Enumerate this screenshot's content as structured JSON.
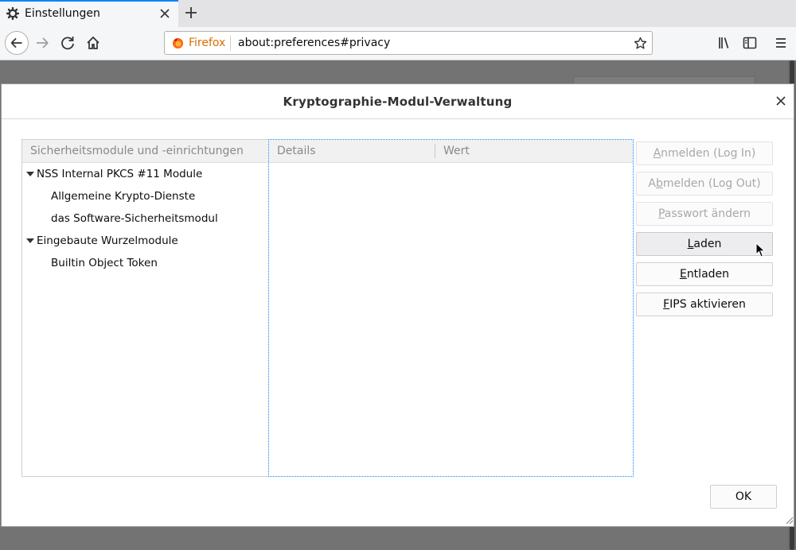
{
  "tab": {
    "title": "Einstellungen",
    "icon": "gear-icon"
  },
  "urlbar": {
    "identity": "Firefox",
    "url": "about:preferences#privacy"
  },
  "dialog": {
    "title": "Kryptographie-Modul-Verwaltung",
    "tree": {
      "header": "Sicherheitsmodule und -einrichtungen",
      "rows": [
        {
          "label": "NSS Internal PKCS #11 Module",
          "level": 1,
          "expanded": true
        },
        {
          "label": "Allgemeine Krypto-Dienste",
          "level": 2
        },
        {
          "label": "das Software-Sicherheitsmodul",
          "level": 2
        },
        {
          "label": "Eingebaute Wurzelmodule",
          "level": 1,
          "expanded": true
        },
        {
          "label": "Builtin Object Token",
          "level": 2
        }
      ]
    },
    "details": {
      "col1": "Details",
      "col2": "Wert"
    },
    "buttons": [
      {
        "pre": "",
        "acc": "A",
        "post": "nmelden (Log In)",
        "disabled": true
      },
      {
        "pre": "A",
        "acc": "b",
        "post": "melden (Log Out)",
        "disabled": true
      },
      {
        "pre": "",
        "acc": "P",
        "post": "asswort ändern",
        "disabled": true
      },
      {
        "pre": "",
        "acc": "L",
        "post": "aden",
        "disabled": false,
        "hover": true
      },
      {
        "pre": "",
        "acc": "E",
        "post": "ntladen",
        "disabled": false
      },
      {
        "pre": "",
        "acc": "F",
        "post": "IPS aktivieren",
        "disabled": false
      }
    ],
    "ok_label": "OK"
  },
  "colors": {
    "accent": "#0a84ff",
    "firefox_label": "#d76e00"
  }
}
